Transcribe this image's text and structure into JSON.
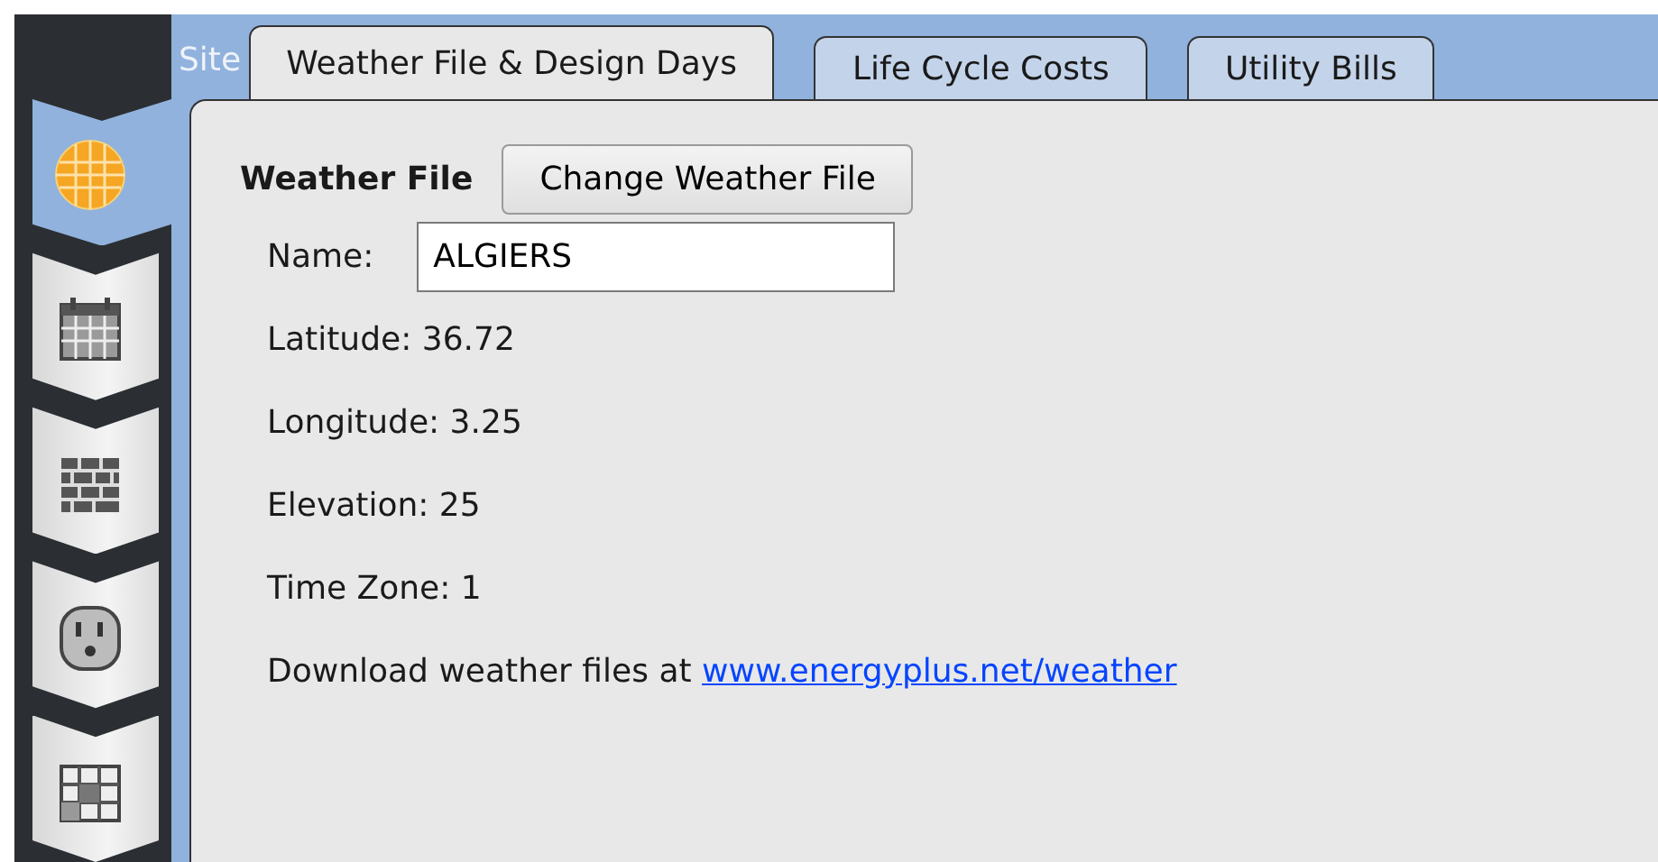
{
  "sidebar": {
    "items": [
      {
        "selected": true
      },
      {
        "selected": false
      },
      {
        "selected": false
      },
      {
        "selected": false
      },
      {
        "selected": false
      }
    ]
  },
  "header": {
    "label": "Site"
  },
  "tabs": [
    {
      "label": "Weather File & Design Days",
      "selected": true
    },
    {
      "label": "Life Cycle Costs",
      "selected": false
    },
    {
      "label": "Utility Bills",
      "selected": false
    }
  ],
  "weather_file": {
    "title": "Weather File",
    "button": "Change Weather File",
    "name_label": "Name:",
    "name_value": "ALGIERS",
    "facts": [
      "Latitude: 36.72",
      "Longitude: 3.25",
      "Elevation: 25",
      "Time Zone: 1"
    ],
    "download_text": "Download weather files at ",
    "download_link": "www.energyplus.net/weather"
  }
}
